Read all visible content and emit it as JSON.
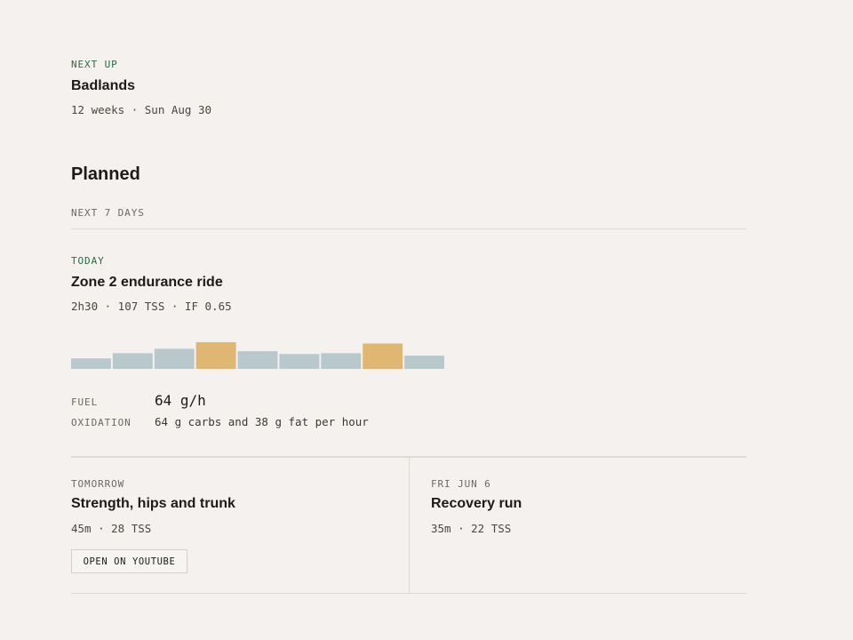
{
  "next_up": {
    "eyebrow": "NEXT UP",
    "title": "Badlands",
    "meta": "12 weeks · Sun Aug 30"
  },
  "planned": {
    "heading": "Planned",
    "window_label": "NEXT 7 DAYS"
  },
  "today": {
    "eyebrow": "TODAY",
    "title": "Zone 2 endurance ride",
    "meta": "2h30 · 107 TSS · IF 0.65",
    "intensity_bars": [
      0.38,
      0.57,
      0.73,
      0.97,
      0.64,
      0.54,
      0.57,
      0.92,
      0.48
    ],
    "bar_levels": [
      "z2",
      "z2",
      "z2",
      "tempo",
      "z2",
      "z2",
      "z2",
      "tempo",
      "z2"
    ],
    "colors": {
      "z2": "#b9c8cc",
      "tempo": "#dfb672"
    },
    "fuel_label": "FUEL",
    "fuel_value": "64 g/h",
    "oxidation_label": "OXIDATION",
    "oxidation_value": "64 g carbs and 38 g fat per hour"
  },
  "tomorrow": {
    "eyebrow": "TOMORROW",
    "title": "Strength, hips and trunk",
    "meta": "45m · 28 TSS",
    "button_label": "OPEN ON YOUTUBE"
  },
  "fri": {
    "eyebrow": "FRI JUN 6",
    "title": "Recovery run",
    "meta": "35m · 22 TSS"
  }
}
